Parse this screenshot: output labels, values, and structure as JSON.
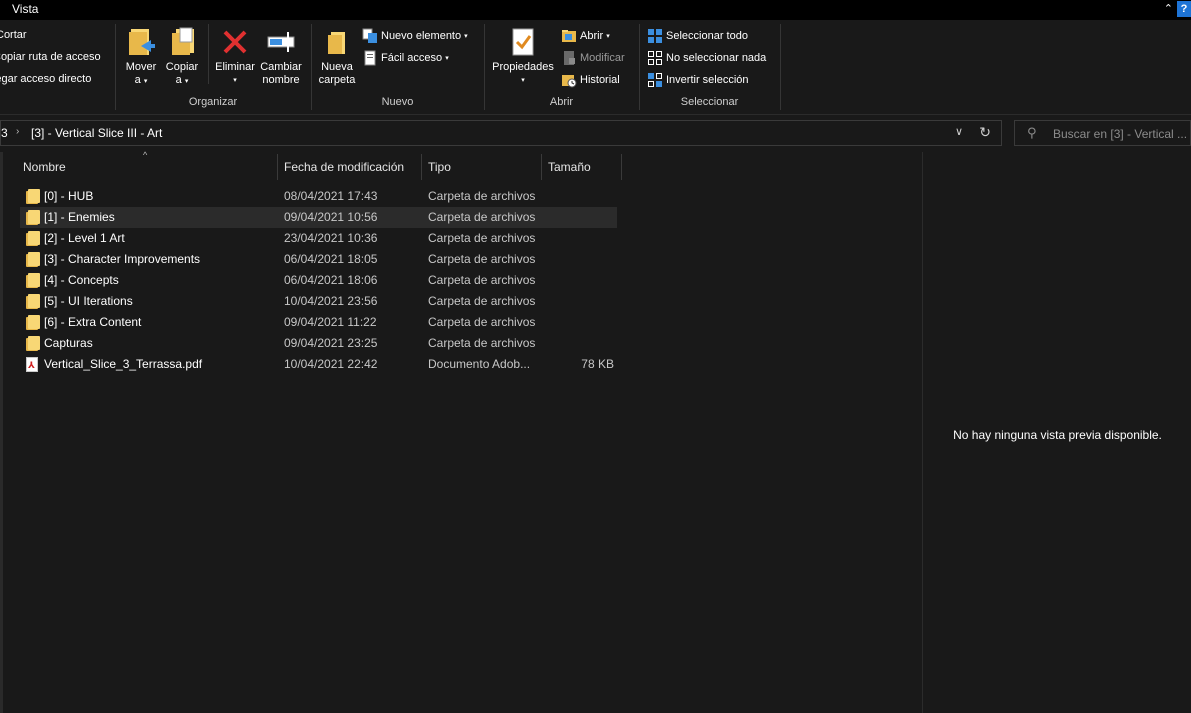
{
  "tabs": {
    "vista": "Vista",
    "collapse": "⌃",
    "help": "?"
  },
  "ribbon": {
    "clipboard_partial": {
      "cortar": "Cortar",
      "copiar_ruta": "Copiar ruta de acceso",
      "pegar_acceso": "Pegar acceso directo"
    },
    "organizar": {
      "label": "Organizar",
      "mover": [
        "Mover",
        "a"
      ],
      "copiar": [
        "Copiar",
        "a"
      ],
      "eliminar": "Eliminar",
      "cambiar": [
        "Cambiar",
        "nombre"
      ]
    },
    "nuevo": {
      "label": "Nuevo",
      "nueva_carpeta": [
        "Nueva",
        "carpeta"
      ],
      "nuevo_elemento": "Nuevo elemento",
      "facil_acceso": "Fácil acceso"
    },
    "abrir": {
      "label": "Abrir",
      "propiedades": "Propiedades",
      "abrir": "Abrir",
      "modificar": "Modificar",
      "historial": "Historial"
    },
    "seleccionar": {
      "label": "Seleccionar",
      "todo": "Seleccionar todo",
      "nada": "No seleccionar nada",
      "invertir": "Invertir selección"
    }
  },
  "address": {
    "crumb_prev": "3",
    "crumb_current": "[3] - Vertical Slice III - Art",
    "search_placeholder": "Buscar en [3] - Vertical ..."
  },
  "columns": {
    "name": "Nombre",
    "date": "Fecha de modificación",
    "type": "Tipo",
    "size": "Tamaño"
  },
  "files": [
    {
      "name": "[0] - HUB",
      "date": "08/04/2021 17:43",
      "type": "Carpeta de archivos",
      "size": "",
      "kind": "folder"
    },
    {
      "name": "[1] - Enemies",
      "date": "09/04/2021 10:56",
      "type": "Carpeta de archivos",
      "size": "",
      "kind": "folder"
    },
    {
      "name": "[2] - Level 1 Art",
      "date": "23/04/2021 10:36",
      "type": "Carpeta de archivos",
      "size": "",
      "kind": "folder"
    },
    {
      "name": "[3] - Character Improvements",
      "date": "06/04/2021 18:05",
      "type": "Carpeta de archivos",
      "size": "",
      "kind": "folder"
    },
    {
      "name": "[4] - Concepts",
      "date": "06/04/2021 18:06",
      "type": "Carpeta de archivos",
      "size": "",
      "kind": "folder"
    },
    {
      "name": "[5] - UI Iterations",
      "date": "10/04/2021 23:56",
      "type": "Carpeta de archivos",
      "size": "",
      "kind": "folder"
    },
    {
      "name": "[6] - Extra Content",
      "date": "09/04/2021 11:22",
      "type": "Carpeta de archivos",
      "size": "",
      "kind": "folder"
    },
    {
      "name": "Capturas",
      "date": "09/04/2021 23:25",
      "type": "Carpeta de archivos",
      "size": "",
      "kind": "folder"
    },
    {
      "name": "Vertical_Slice_3_Terrassa.pdf",
      "date": "10/04/2021 22:42",
      "type": "Documento Adob...",
      "size": "78 KB",
      "kind": "pdf"
    }
  ],
  "preview": {
    "message": "No hay ninguna vista previa disponible."
  }
}
